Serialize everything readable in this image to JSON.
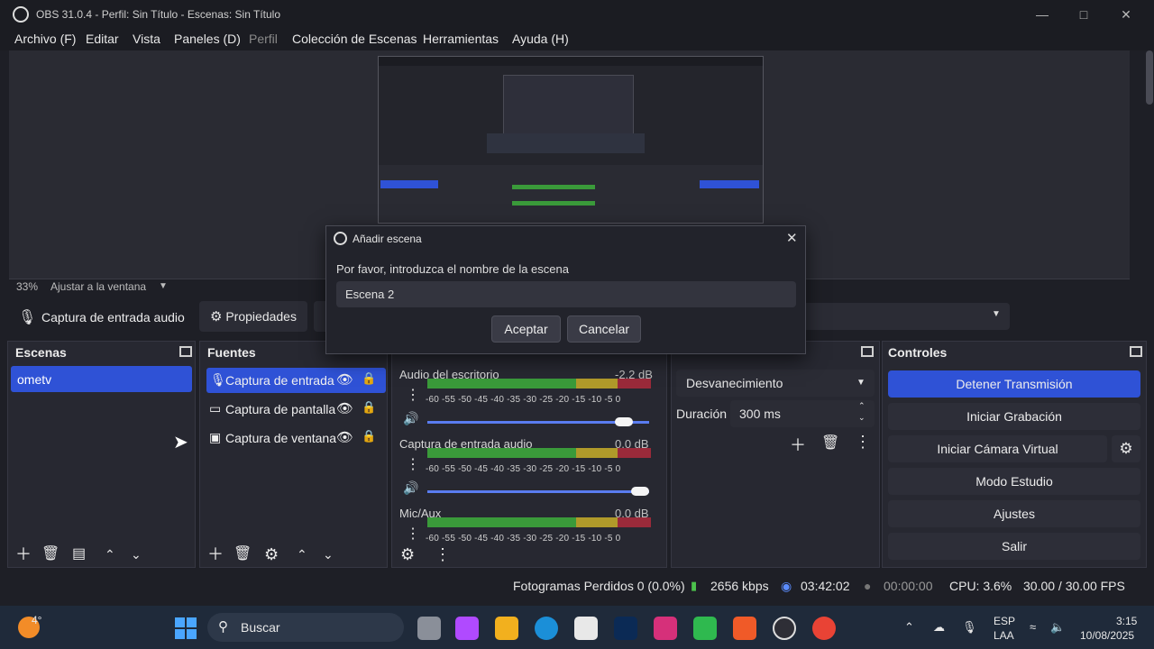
{
  "window": {
    "title": "OBS 31.0.4 - Perfil: Sin Título - Escenas: Sin Título"
  },
  "menu": [
    "Archivo (F)",
    "Editar",
    "Vista",
    "Paneles (D)",
    "Perfil",
    "Colección de Escenas",
    "Herramientas",
    "Ayuda (H)"
  ],
  "preview": {
    "zoom": "33%",
    "fit_label": "Ajustar a la ventana"
  },
  "source_toolbar": {
    "source_name": "Captura de entrada audio",
    "properties_label": "Propiedades"
  },
  "scenes": {
    "title": "Escenas",
    "items": [
      "ometv"
    ]
  },
  "sources": {
    "title": "Fuentes",
    "items": [
      {
        "label": "Captura de entrada",
        "icon": "microphone-icon"
      },
      {
        "label": "Captura de pantalla",
        "icon": "monitor-icon"
      },
      {
        "label": "Captura de ventana",
        "icon": "window-icon"
      }
    ]
  },
  "mixer": {
    "channels": [
      {
        "name": "Audio del escritorio",
        "db": "-2.2 dB",
        "volume_fraction": 0.92
      },
      {
        "name": "Captura de entrada audio",
        "db": "0.0 dB",
        "volume_fraction": 1.0
      },
      {
        "name": "Mic/Aux",
        "db": "0.0 dB",
        "volume_fraction": 1.0
      }
    ],
    "scale": "-60 -55 -50 -45 -40 -35 -30 -25 -20 -15 -10 -5 0"
  },
  "transitions": {
    "selected": "Desvanecimiento",
    "duration_label": "Duración",
    "duration_value": "300 ms"
  },
  "controls": {
    "title": "Controles",
    "buttons": [
      "Detener Transmisión",
      "Iniciar Grabación",
      "Iniciar Cámara Virtual",
      "Modo Estudio",
      "Ajustes",
      "Salir"
    ]
  },
  "status": {
    "dropped": "Fotogramas Perdidos 0 (0.0%)",
    "bitrate": "2656 kbps",
    "stream_time": "03:42:02",
    "rec_time": "00:00:00",
    "cpu": "CPU: 3.6%",
    "fps": "30.00 / 30.00 FPS"
  },
  "dialog": {
    "title": "Añadir escena",
    "prompt": "Por favor, introduzca el nombre de la escena",
    "value": "Escena 2",
    "ok": "Aceptar",
    "cancel": "Cancelar"
  },
  "taskbar": {
    "weather": "4°",
    "search_placeholder": "Buscar",
    "lang_top": "ESP",
    "lang_bottom": "LAA",
    "time": "3:15",
    "date": "10/08/2025"
  },
  "colors": {
    "accent": "#2f52d6",
    "meter_green": "#3a9a3a",
    "meter_yellow": "#b09a2a",
    "meter_red": "#9a2a3a"
  }
}
